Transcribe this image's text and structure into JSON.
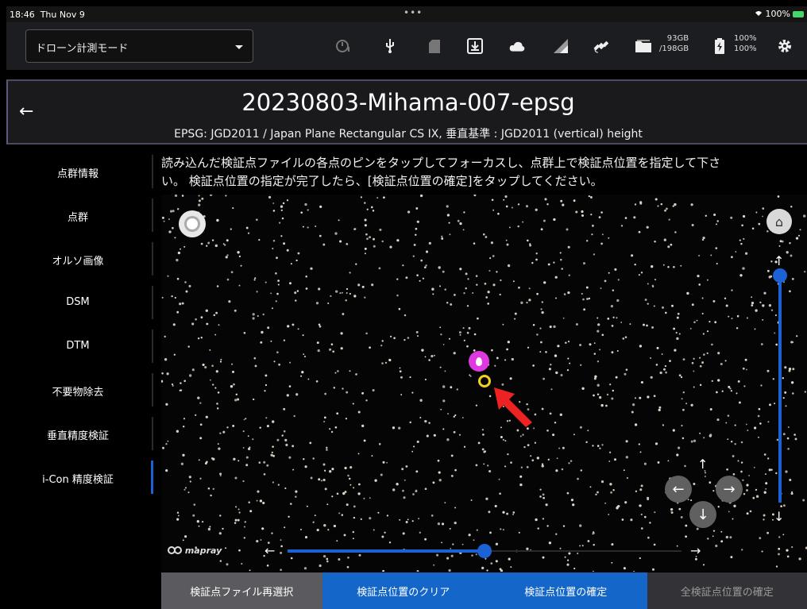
{
  "status_bar": {
    "time": "18:46",
    "date": "Thu Nov 9",
    "dots": "•••",
    "battery": "100%"
  },
  "toolbar": {
    "mode_select": "ドローン計測モード",
    "storage_used": "93GB",
    "storage_total": "/198GB",
    "battery_1": "100%",
    "battery_2": "100%"
  },
  "header": {
    "title": "20230803-Mihama-007-epsg",
    "subtitle": "EPSG: JGD2011 / Japan Plane Rectangular CS IX, 垂直基準 : JGD2011 (vertical) height"
  },
  "sidebar": {
    "items": [
      {
        "label": "点群情報"
      },
      {
        "label": "点群"
      },
      {
        "label": "オルソ画像"
      },
      {
        "label": "DSM"
      },
      {
        "label": "DTM"
      },
      {
        "label": "不要物除去"
      },
      {
        "label": "垂直精度検証"
      },
      {
        "label": "i-Con 精度検証"
      }
    ],
    "active_index": 7
  },
  "instructions": {
    "line1": "読み込んだ検証点ファイルの各点のピンをタップしてフォーカスし、点群上で検証点位置を指定して下さ",
    "line2": "い。 検証点位置の指定が完了したら、[検証点位置の確定]をタップしてください。"
  },
  "viewer": {
    "logo": "mapray",
    "accent_color": "#1b62d6",
    "pin_color": "#e038e0",
    "target_color": "#f2d21b",
    "arrow_up": "↑",
    "arrow_down": "↓",
    "arrow_left": "←",
    "arrow_right": "→",
    "home_icon": "⌂"
  },
  "buttons": {
    "reselect": "検証点ファイル再選択",
    "clear": "検証点位置のクリア",
    "confirm": "検証点位置の確定",
    "confirm_all": "全検証点位置の確定"
  }
}
